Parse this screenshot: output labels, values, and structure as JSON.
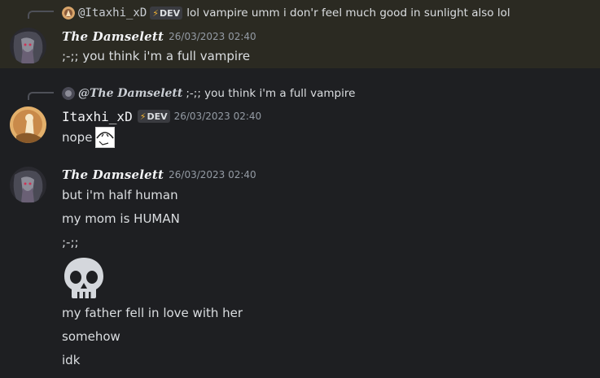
{
  "messages": [
    {
      "reply": {
        "author": "@Itaxhi_xD",
        "badge": "DEV",
        "text": "lol vampire umm i don'r feel much good in sunlight also lol"
      },
      "author": "The Damselett",
      "timestamp": "26/03/2023 02:40",
      "lines": [
        ";-;; you think i'm a full vampire"
      ]
    },
    {
      "reply": {
        "author": "@The Damselett",
        "text": ";-;; you think i'm a full vampire"
      },
      "author": "Itaxhi_xD",
      "badge": "DEV",
      "timestamp": "26/03/2023 02:40",
      "lines": [
        "nope"
      ]
    },
    {
      "author": "The Damselett",
      "timestamp": "26/03/2023 02:40",
      "lines": [
        "but i'm half human",
        "my mom is HUMAN",
        ";-;;",
        "my father fell in love with her",
        "somehow",
        "idk"
      ]
    }
  ],
  "colors": {
    "background": "#1e1f22",
    "highlight": "#2b2a22",
    "badge_bolt": "#f0b232",
    "timestamp": "#949ba4"
  },
  "icons": {
    "badge": "lightning-bolt-icon",
    "sticker": "peeking-face-sticker",
    "emoji": "skull-emoji"
  }
}
